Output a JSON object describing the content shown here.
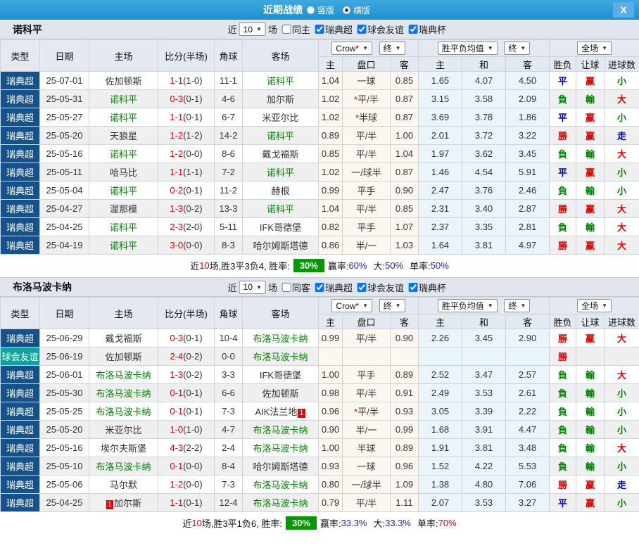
{
  "titlebar": {
    "title": "近期战绩",
    "radios": [
      {
        "label": "竖版",
        "checked": false
      },
      {
        "label": "横版",
        "checked": true
      }
    ],
    "close_label": "X"
  },
  "colors": {
    "titlebar_blue": "#2095d4",
    "league_blue": "#17518a",
    "friendly_teal": "#0fa3a0",
    "focal_green": "#008000",
    "score_red": "#e60000",
    "rate_badge_green": "#009900",
    "value_blue": "#2222cc"
  },
  "sections": [
    {
      "team": "诺科平",
      "filter": {
        "near_label": "近",
        "count": "10",
        "games_label": "场",
        "same": {
          "label": "同主",
          "checked": false
        },
        "leagues": [
          {
            "label": "瑞典超",
            "checked": true
          },
          {
            "label": "球会友谊",
            "checked": true
          },
          {
            "label": "瑞典杯",
            "checked": true
          }
        ]
      },
      "header": {
        "cols": [
          "类型",
          "日期",
          "主场",
          "比分(半场)",
          "角球",
          "客场"
        ],
        "group1": "Crow*",
        "final1": "终",
        "group2": "胜平负均值",
        "final2": "终",
        "group3": "全场",
        "sub": [
          "主",
          "盘口",
          "客",
          "主",
          "和",
          "客",
          "胜负",
          "让球",
          "进球数"
        ]
      },
      "rows": [
        {
          "league": "瑞典超",
          "friendly": false,
          "date": "25-07-01",
          "home": "佐加顿斯",
          "home_focal": false,
          "home_badge": "",
          "home_badge_pos": "",
          "score": "1-1",
          "half": "(1-0)",
          "corner": "11-1",
          "away": "诺科平",
          "away_focal": true,
          "away_badge": "",
          "away_badge_pos": "",
          "o_home": "1.04",
          "handicap": "一球",
          "star": false,
          "o_away": "0.85",
          "avg_home": "1.65",
          "avg_draw": "4.07",
          "avg_away": "4.50",
          "res": "平",
          "let": "赢",
          "goal": "小"
        },
        {
          "league": "瑞典超",
          "friendly": false,
          "date": "25-05-31",
          "home": "诺科平",
          "home_focal": true,
          "home_badge": "",
          "home_badge_pos": "",
          "score": "0-3",
          "half": "(0-1)",
          "corner": "4-6",
          "away": "加尔斯",
          "away_focal": false,
          "away_badge": "",
          "away_badge_pos": "",
          "o_home": "1.02",
          "handicap": "平/半",
          "star": true,
          "o_away": "0.87",
          "avg_home": "3.15",
          "avg_draw": "3.58",
          "avg_away": "2.09",
          "res": "負",
          "let": "輸",
          "goal": "大"
        },
        {
          "league": "瑞典超",
          "friendly": false,
          "date": "25-05-27",
          "home": "诺科平",
          "home_focal": true,
          "home_badge": "",
          "home_badge_pos": "",
          "score": "1-1",
          "half": "(0-1)",
          "corner": "6-7",
          "away": "米亚尔比",
          "away_focal": false,
          "away_badge": "",
          "away_badge_pos": "",
          "o_home": "1.02",
          "handicap": "半球",
          "star": true,
          "o_away": "0.87",
          "avg_home": "3.69",
          "avg_draw": "3.78",
          "avg_away": "1.86",
          "res": "平",
          "let": "赢",
          "goal": "小"
        },
        {
          "league": "瑞典超",
          "friendly": false,
          "date": "25-05-20",
          "home": "天狼星",
          "home_focal": false,
          "home_badge": "",
          "home_badge_pos": "",
          "score": "1-2",
          "half": "(1-2)",
          "corner": "14-2",
          "away": "诺科平",
          "away_focal": true,
          "away_badge": "",
          "away_badge_pos": "",
          "o_home": "0.89",
          "handicap": "平/半",
          "star": false,
          "o_away": "1.00",
          "avg_home": "2.01",
          "avg_draw": "3.72",
          "avg_away": "3.22",
          "res": "勝",
          "let": "赢",
          "goal": "走"
        },
        {
          "league": "瑞典超",
          "friendly": false,
          "date": "25-05-16",
          "home": "诺科平",
          "home_focal": true,
          "home_badge": "",
          "home_badge_pos": "",
          "score": "1-2",
          "half": "(0-0)",
          "corner": "8-6",
          "away": "戴戈福斯",
          "away_focal": false,
          "away_badge": "",
          "away_badge_pos": "",
          "o_home": "0.85",
          "handicap": "平/半",
          "star": false,
          "o_away": "1.04",
          "avg_home": "1.97",
          "avg_draw": "3.62",
          "avg_away": "3.45",
          "res": "負",
          "let": "輸",
          "goal": "大"
        },
        {
          "league": "瑞典超",
          "friendly": false,
          "date": "25-05-11",
          "home": "哈马比",
          "home_focal": false,
          "home_badge": "",
          "home_badge_pos": "",
          "score": "1-1",
          "half": "(1-1)",
          "corner": "7-2",
          "away": "诺科平",
          "away_focal": true,
          "away_badge": "",
          "away_badge_pos": "",
          "o_home": "1.02",
          "handicap": "一/球半",
          "star": false,
          "o_away": "0.87",
          "avg_home": "1.46",
          "avg_draw": "4.54",
          "avg_away": "5.91",
          "res": "平",
          "let": "赢",
          "goal": "小"
        },
        {
          "league": "瑞典超",
          "friendly": false,
          "date": "25-05-04",
          "home": "诺科平",
          "home_focal": true,
          "home_badge": "",
          "home_badge_pos": "",
          "score": "0-2",
          "half": "(0-1)",
          "corner": "11-2",
          "away": "赫根",
          "away_focal": false,
          "away_badge": "",
          "away_badge_pos": "",
          "o_home": "0.99",
          "handicap": "平手",
          "star": false,
          "o_away": "0.90",
          "avg_home": "2.47",
          "avg_draw": "3.76",
          "avg_away": "2.46",
          "res": "負",
          "let": "輸",
          "goal": "小"
        },
        {
          "league": "瑞典超",
          "friendly": false,
          "date": "25-04-27",
          "home": "渥那模",
          "home_focal": false,
          "home_badge": "",
          "home_badge_pos": "",
          "score": "1-3",
          "half": "(0-2)",
          "corner": "13-3",
          "away": "诺科平",
          "away_focal": true,
          "away_badge": "",
          "away_badge_pos": "",
          "o_home": "1.04",
          "handicap": "平/半",
          "star": false,
          "o_away": "0.85",
          "avg_home": "2.31",
          "avg_draw": "3.40",
          "avg_away": "2.87",
          "res": "勝",
          "let": "赢",
          "goal": "大"
        },
        {
          "league": "瑞典超",
          "friendly": false,
          "date": "25-04-25",
          "home": "诺科平",
          "home_focal": true,
          "home_badge": "",
          "home_badge_pos": "",
          "score": "2-3",
          "half": "(2-0)",
          "corner": "5-11",
          "away": "IFK哥德堡",
          "away_focal": false,
          "away_badge": "",
          "away_badge_pos": "",
          "o_home": "0.82",
          "handicap": "平手",
          "star": false,
          "o_away": "1.07",
          "avg_home": "2.37",
          "avg_draw": "3.35",
          "avg_away": "2.81",
          "res": "負",
          "let": "輸",
          "goal": "大"
        },
        {
          "league": "瑞典超",
          "friendly": false,
          "date": "25-04-19",
          "home": "诺科平",
          "home_focal": true,
          "home_badge": "",
          "home_badge_pos": "",
          "score": "3-0",
          "half": "(0-0)",
          "corner": "8-3",
          "away": "哈尔姆斯塔德",
          "away_focal": false,
          "away_badge": "",
          "away_badge_pos": "",
          "o_home": "0.86",
          "handicap": "半/一",
          "star": false,
          "o_away": "1.03",
          "avg_home": "1.64",
          "avg_draw": "3.81",
          "avg_away": "4.97",
          "res": "勝",
          "let": "赢",
          "goal": "大"
        }
      ],
      "summary": {
        "lead": "近",
        "num": "10",
        "text": "场,胜3平3负4, 胜率:",
        "rate": "30%",
        "win_label": "赢率:",
        "win": "60%",
        "big_label": "大:",
        "big": "50%",
        "single_label": "单率:",
        "single": "50%",
        "single_red": false
      }
    },
    {
      "team": "布洛马波卡纳",
      "filter": {
        "near_label": "近",
        "count": "10",
        "games_label": "场",
        "same": {
          "label": "同客",
          "checked": false
        },
        "leagues": [
          {
            "label": "瑞典超",
            "checked": true
          },
          {
            "label": "球会友谊",
            "checked": true
          },
          {
            "label": "瑞典杯",
            "checked": true
          }
        ]
      },
      "header": {
        "cols": [
          "类型",
          "日期",
          "主场",
          "比分(半场)",
          "角球",
          "客场"
        ],
        "group1": "Crow*",
        "final1": "终",
        "group2": "胜平负均值",
        "final2": "终",
        "group3": "全场",
        "sub": [
          "主",
          "盘口",
          "客",
          "主",
          "和",
          "客",
          "胜负",
          "让球",
          "进球数"
        ]
      },
      "rows": [
        {
          "league": "瑞典超",
          "friendly": false,
          "date": "25-06-29",
          "home": "戴戈福斯",
          "home_focal": false,
          "home_badge": "",
          "home_badge_pos": "",
          "score": "0-3",
          "half": "(0-1)",
          "corner": "10-4",
          "away": "布洛马波卡纳",
          "away_focal": true,
          "away_badge": "",
          "away_badge_pos": "",
          "o_home": "0.99",
          "handicap": "平/半",
          "star": false,
          "o_away": "0.90",
          "avg_home": "2.26",
          "avg_draw": "3.45",
          "avg_away": "2.90",
          "res": "勝",
          "let": "赢",
          "goal": "大"
        },
        {
          "league": "球会友谊",
          "friendly": true,
          "date": "25-06-19",
          "home": "佐加顿斯",
          "home_focal": false,
          "home_badge": "",
          "home_badge_pos": "",
          "score": "2-4",
          "half": "(0-2)",
          "corner": "0-0",
          "away": "布洛马波卡纳",
          "away_focal": true,
          "away_badge": "",
          "away_badge_pos": "",
          "o_home": "",
          "handicap": "",
          "star": false,
          "o_away": "",
          "avg_home": "",
          "avg_draw": "",
          "avg_away": "",
          "res": "勝",
          "let": "",
          "goal": ""
        },
        {
          "league": "瑞典超",
          "friendly": false,
          "date": "25-06-01",
          "home": "布洛马波卡纳",
          "home_focal": true,
          "home_badge": "",
          "home_badge_pos": "",
          "score": "1-3",
          "half": "(0-2)",
          "corner": "3-3",
          "away": "IFK哥德堡",
          "away_focal": false,
          "away_badge": "",
          "away_badge_pos": "",
          "o_home": "1.00",
          "handicap": "平手",
          "star": false,
          "o_away": "0.89",
          "avg_home": "2.52",
          "avg_draw": "3.47",
          "avg_away": "2.57",
          "res": "負",
          "let": "輸",
          "goal": "大"
        },
        {
          "league": "瑞典超",
          "friendly": false,
          "date": "25-05-30",
          "home": "布洛马波卡纳",
          "home_focal": true,
          "home_badge": "",
          "home_badge_pos": "",
          "score": "0-1",
          "half": "(0-1)",
          "corner": "6-6",
          "away": "佐加顿斯",
          "away_focal": false,
          "away_badge": "",
          "away_badge_pos": "",
          "o_home": "0.98",
          "handicap": "平/半",
          "star": false,
          "o_away": "0.91",
          "avg_home": "2.49",
          "avg_draw": "3.53",
          "avg_away": "2.61",
          "res": "負",
          "let": "輸",
          "goal": "小"
        },
        {
          "league": "瑞典超",
          "friendly": false,
          "date": "25-05-25",
          "home": "布洛马波卡纳",
          "home_focal": true,
          "home_badge": "",
          "home_badge_pos": "",
          "score": "0-1",
          "half": "(0-1)",
          "corner": "7-3",
          "away": "AIK法兰地",
          "away_focal": false,
          "away_badge": "1",
          "away_badge_pos": "after",
          "o_home": "0.96",
          "handicap": "平/半",
          "star": true,
          "o_away": "0.93",
          "avg_home": "3.05",
          "avg_draw": "3.39",
          "avg_away": "2.22",
          "res": "負",
          "let": "輸",
          "goal": "小"
        },
        {
          "league": "瑞典超",
          "friendly": false,
          "date": "25-05-20",
          "home": "米亚尔比",
          "home_focal": false,
          "home_badge": "",
          "home_badge_pos": "",
          "score": "1-0",
          "half": "(1-0)",
          "corner": "4-7",
          "away": "布洛马波卡纳",
          "away_focal": true,
          "away_badge": "",
          "away_badge_pos": "",
          "o_home": "0.90",
          "handicap": "半/一",
          "star": false,
          "o_away": "0.99",
          "avg_home": "1.68",
          "avg_draw": "3.91",
          "avg_away": "4.47",
          "res": "負",
          "let": "輸",
          "goal": "小"
        },
        {
          "league": "瑞典超",
          "friendly": false,
          "date": "25-05-16",
          "home": "埃尔夫斯堡",
          "home_focal": false,
          "home_badge": "",
          "home_badge_pos": "",
          "score": "4-3",
          "half": "(2-2)",
          "corner": "2-4",
          "away": "布洛马波卡纳",
          "away_focal": true,
          "away_badge": "",
          "away_badge_pos": "",
          "o_home": "1.00",
          "handicap": "半球",
          "star": false,
          "o_away": "0.89",
          "avg_home": "1.91",
          "avg_draw": "3.81",
          "avg_away": "3.48",
          "res": "負",
          "let": "輸",
          "goal": "大"
        },
        {
          "league": "瑞典超",
          "friendly": false,
          "date": "25-05-10",
          "home": "布洛马波卡纳",
          "home_focal": true,
          "home_badge": "",
          "home_badge_pos": "",
          "score": "0-1",
          "half": "(0-0)",
          "corner": "8-4",
          "away": "哈尔姆斯塔德",
          "away_focal": false,
          "away_badge": "",
          "away_badge_pos": "",
          "o_home": "0.93",
          "handicap": "一球",
          "star": false,
          "o_away": "0.96",
          "avg_home": "1.52",
          "avg_draw": "4.22",
          "avg_away": "5.53",
          "res": "負",
          "let": "輸",
          "goal": "小"
        },
        {
          "league": "瑞典超",
          "friendly": false,
          "date": "25-05-06",
          "home": "马尔默",
          "home_focal": false,
          "home_badge": "",
          "home_badge_pos": "",
          "score": "1-2",
          "half": "(0-0)",
          "corner": "7-3",
          "away": "布洛马波卡纳",
          "away_focal": true,
          "away_badge": "",
          "away_badge_pos": "",
          "o_home": "0.80",
          "handicap": "一/球半",
          "star": false,
          "o_away": "1.09",
          "avg_home": "1.38",
          "avg_draw": "4.80",
          "avg_away": "7.06",
          "res": "勝",
          "let": "赢",
          "goal": "走"
        },
        {
          "league": "瑞典超",
          "friendly": false,
          "date": "25-04-25",
          "home": "加尔斯",
          "home_focal": false,
          "home_badge": "1",
          "home_badge_pos": "before",
          "score": "1-1",
          "half": "(0-1)",
          "corner": "12-4",
          "away": "布洛马波卡纳",
          "away_focal": true,
          "away_badge": "",
          "away_badge_pos": "",
          "o_home": "0.79",
          "handicap": "平/半",
          "star": false,
          "o_away": "1.11",
          "avg_home": "2.07",
          "avg_draw": "3.53",
          "avg_away": "3.27",
          "res": "平",
          "let": "赢",
          "goal": "小"
        }
      ],
      "summary": {
        "lead": "近",
        "num": "10",
        "text": "场,胜3平1负6, 胜率:",
        "rate": "30%",
        "win_label": "赢率:",
        "win": "33.3%",
        "big_label": "大:",
        "big": "33.3%",
        "single_label": "单率:",
        "single": "70%",
        "single_red": true
      }
    }
  ]
}
